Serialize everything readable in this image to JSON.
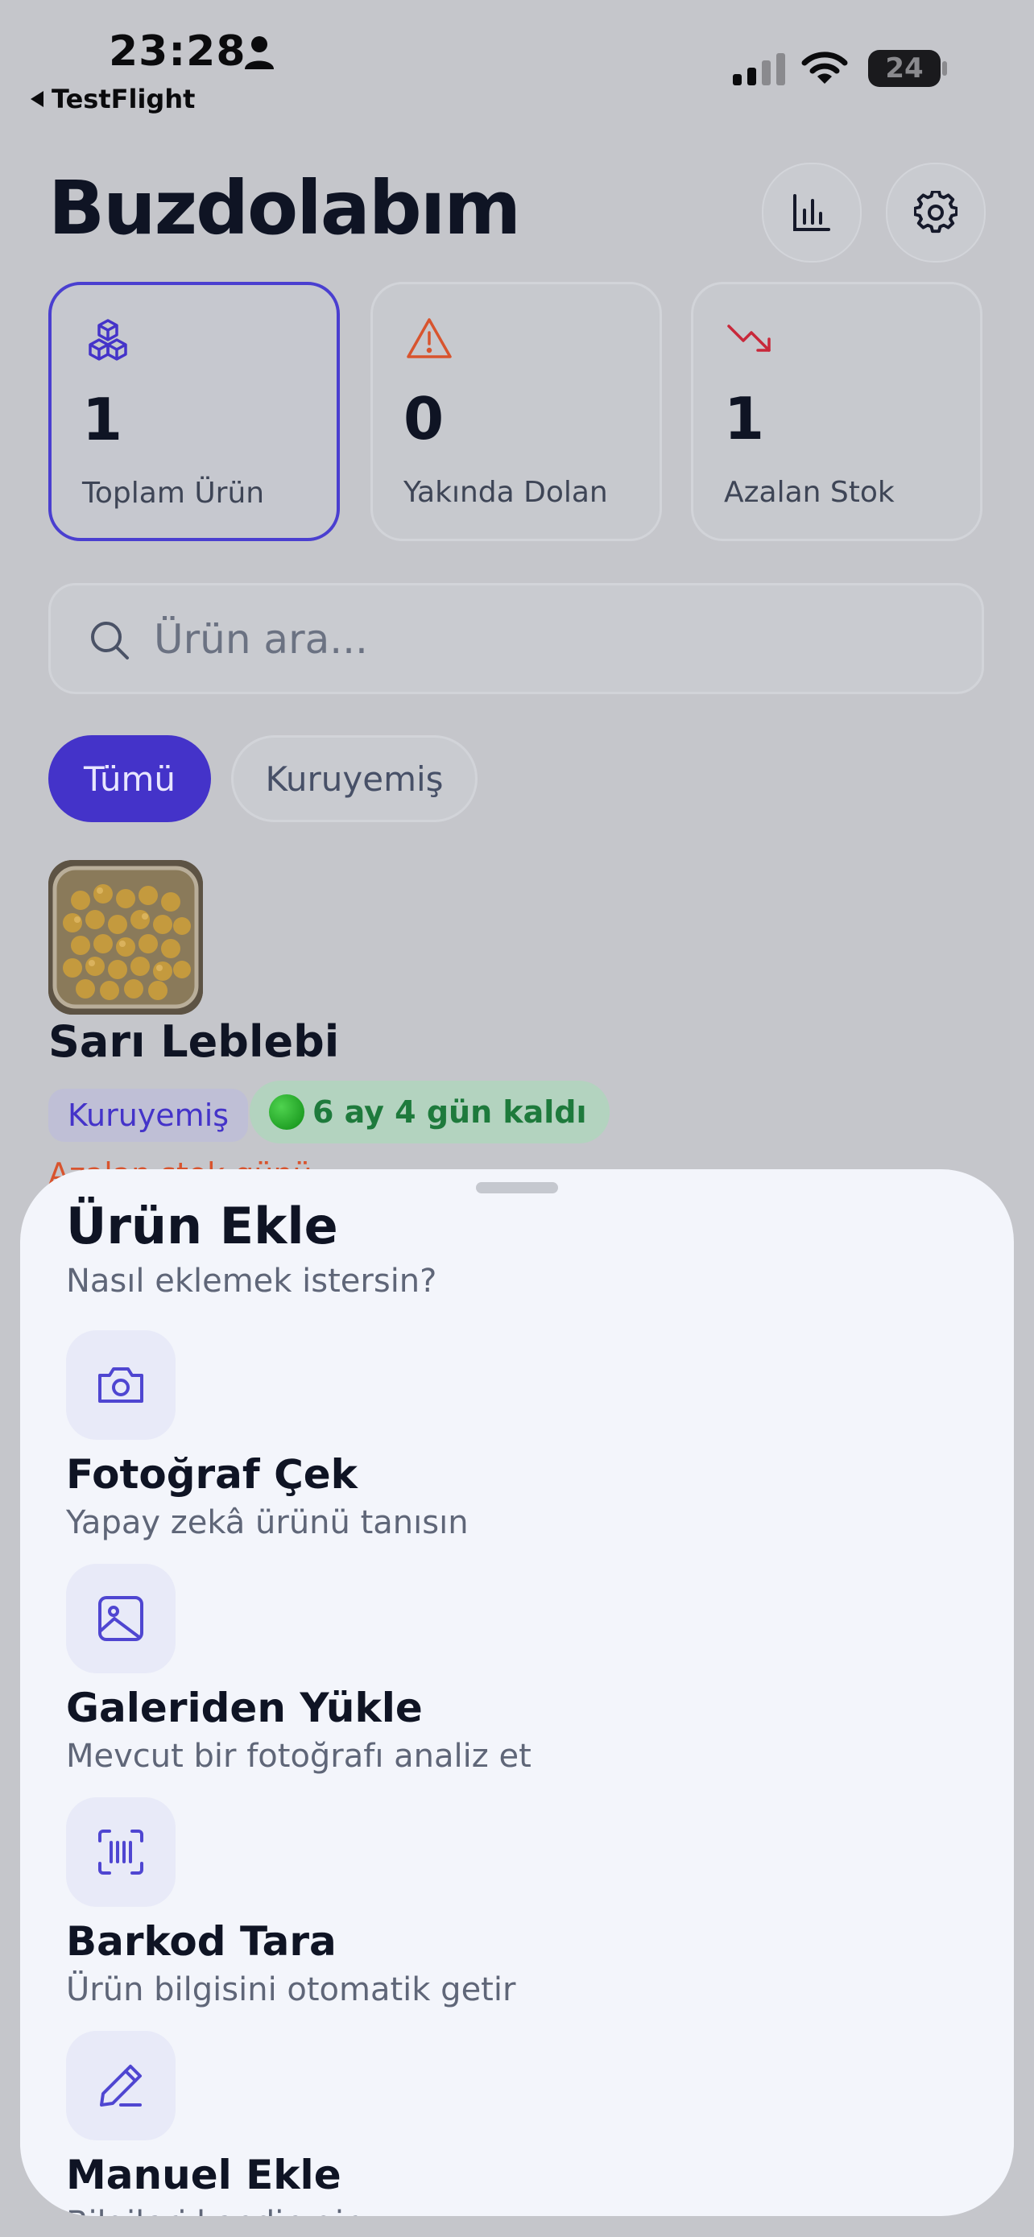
{
  "status_bar": {
    "time": "23:28",
    "back_label": "TestFlight",
    "battery": "24"
  },
  "header": {
    "title": "Buzdolabım"
  },
  "stats": [
    {
      "value": "1",
      "label": "Toplam Ürün"
    },
    {
      "value": "0",
      "label": "Yakında Dolan"
    },
    {
      "value": "1",
      "label": "Azalan Stok"
    }
  ],
  "search": {
    "placeholder": "Ürün ara..."
  },
  "filters": [
    {
      "label": "Tümü"
    },
    {
      "label": "Kuruyemiş"
    }
  ],
  "product": {
    "name": "Sarı Leblebi",
    "category": "Kuruyemiş",
    "expiry": "6 ay 4 gün kaldı",
    "peek_text": "Azalan stok günü"
  },
  "sheet": {
    "title": "Ürün Ekle",
    "subtitle": "Nasıl eklemek istersin?",
    "options": [
      {
        "title": "Fotoğraf Çek",
        "desc": "Yapay zekâ ürünü tanısın"
      },
      {
        "title": "Galeriden Yükle",
        "desc": "Mevcut bir fotoğrafı analiz et"
      },
      {
        "title": "Barkod Tara",
        "desc": "Ürün bilgisini otomatik getir"
      },
      {
        "title": "Manuel Ekle",
        "desc": "Bilgileri kendin gir"
      }
    ]
  },
  "colors": {
    "accent": "#4433c9",
    "warning": "#d8542e",
    "danger": "#c8283a",
    "success": "#1e7a3c"
  }
}
